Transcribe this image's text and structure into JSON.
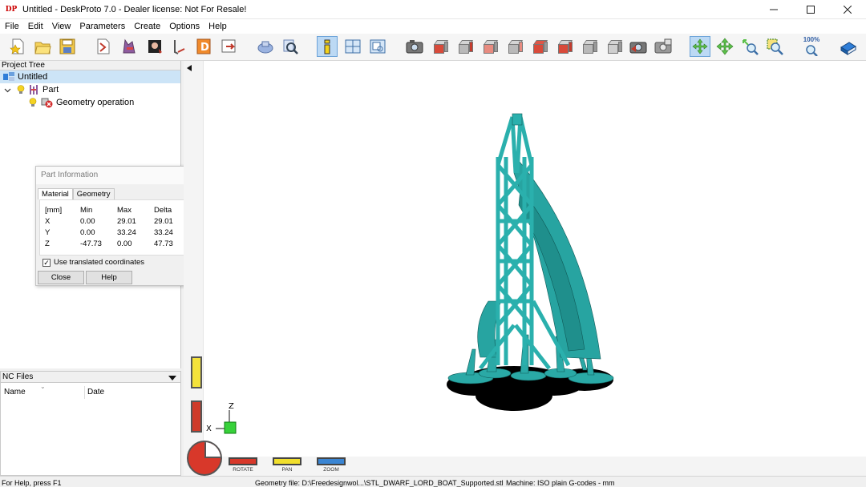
{
  "window": {
    "app_icon": "DP",
    "title": "Untitled - DeskProto 7.0 - Dealer license: Not For Resale!",
    "controls": [
      "minimize-icon",
      "maximize-icon",
      "close-icon"
    ]
  },
  "menu": [
    "File",
    "Edit",
    "View",
    "Parameters",
    "Create",
    "Options",
    "Help"
  ],
  "toolbar": {
    "icons": [
      "new-file-icon",
      "open-folder-icon",
      "save-icon",
      "import-geometry-icon",
      "add-part-icon",
      "add-bitmap-icon",
      "add-vector-icon",
      "add-project-icon",
      "export-icon",
      "select-part-icon",
      "view-part-icon",
      "part-info-icon",
      "split-view-icon",
      "view-window-icon",
      "camera-icon",
      "view-front-icon",
      "view-right-icon",
      "view-back-icon",
      "view-left-icon",
      "view-top-icon",
      "view-bottom-icon",
      "view-iso-icon",
      "view-iso2-icon",
      "capture-icon",
      "print-icon",
      "rotate-view-icon",
      "pan-view-icon",
      "zoom-view-icon",
      "zoom-window-icon",
      "zoom-100-icon",
      "help-book-icon"
    ],
    "zoom_label": "100%"
  },
  "project_tree": {
    "header": "Project Tree",
    "root": "Untitled",
    "part": "Part",
    "operation": "Geometry operation"
  },
  "part_info": {
    "title": "Part Information",
    "tabs": [
      "Material",
      "Geometry"
    ],
    "columns": [
      "[mm]",
      "Min",
      "Max",
      "Delta"
    ],
    "rows": [
      {
        "axis": "X",
        "min": "0.00",
        "max": "29.01",
        "delta": "29.01"
      },
      {
        "axis": "Y",
        "min": "0.00",
        "max": "33.24",
        "delta": "33.24"
      },
      {
        "axis": "Z",
        "min": "-47.73",
        "max": "0.00",
        "delta": "47.73"
      }
    ],
    "checkbox_label": "Use translated coordinates",
    "checkbox_checked": true,
    "close_label": "Close",
    "help_label": "Help"
  },
  "nc_files": {
    "header": "NC Files",
    "columns": [
      "Name",
      "Date"
    ]
  },
  "viewport": {
    "model_color": "#29aaa8",
    "axis_z": "Z",
    "axis_x": "X",
    "nav_labels": [
      "ROTATE",
      "PAN",
      "ZOOM"
    ]
  },
  "status": {
    "help": "For Help, press F1",
    "geometry_file": "Geometry file: D:\\Freedesignwol...\\STL_DWARF_LORD_BOAT_Supported.stl",
    "machine": "Machine: ISO plain G-codes - mm"
  }
}
